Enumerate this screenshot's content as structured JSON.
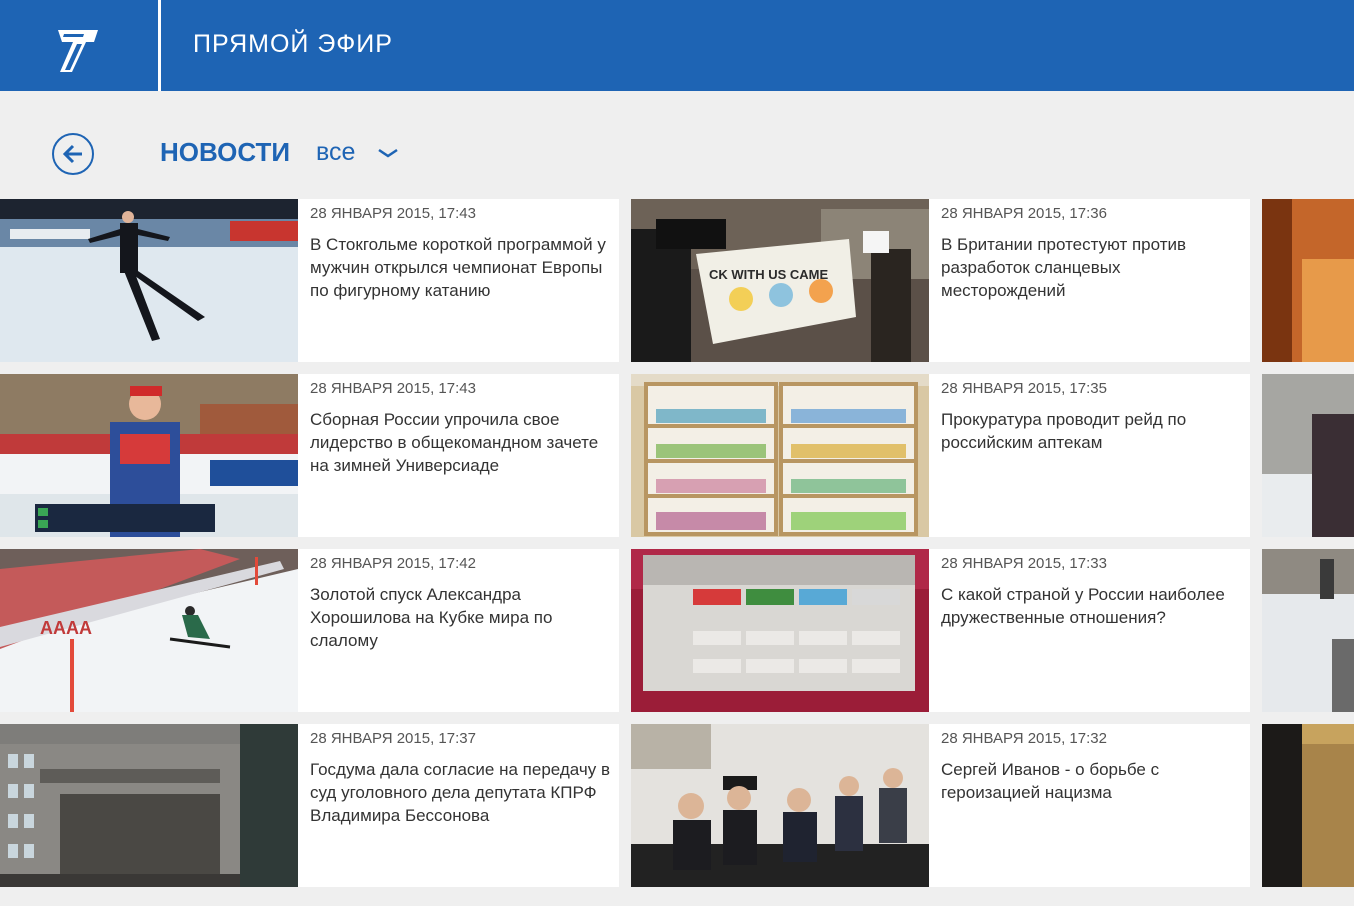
{
  "header": {
    "logo": "channel-one-logo",
    "live_label": "ПРЯМОЙ ЭФИР",
    "brand_color": "#1e64b4"
  },
  "page": {
    "title": "НОВОСТИ",
    "filter_label": "все"
  },
  "news": [
    {
      "date": "28 ЯНВАРЯ 2015, 17:43",
      "headline": "В Стокгольме короткой программой у мужчин открылся чемпионат Европы по фигурному катанию"
    },
    {
      "date": "28 ЯНВАРЯ 2015, 17:36",
      "headline": "В Британии протестуют против разработок сланцевых месторождений"
    },
    {
      "date": "28 ЯНВАРЯ 2015, 17:43",
      "headline": "Сборная России упрочила свое лидерство в общекомандном зачете на зимней Универсиаде"
    },
    {
      "date": "28 ЯНВАРЯ 2015, 17:35",
      "headline": "Прокуратура проводит рейд по российским аптекам"
    },
    {
      "date": "28 ЯНВАРЯ 2015, 17:42",
      "headline": "Золотой спуск Александра Хорошилова на Кубке мира по слалому"
    },
    {
      "date": "28 ЯНВАРЯ 2015, 17:33",
      "headline": "С какой страной у России наиболее дружественные отношения?"
    },
    {
      "date": "28 ЯНВАРЯ 2015, 17:37",
      "headline": "Госдума дала согласие на передачу в суд уголовного дела депутата КПРФ Владимира Бессонова"
    },
    {
      "date": "28 ЯНВАРЯ 2015, 17:32",
      "headline": "Сергей Иванов - о борьбе с героизацией нацизма"
    }
  ]
}
